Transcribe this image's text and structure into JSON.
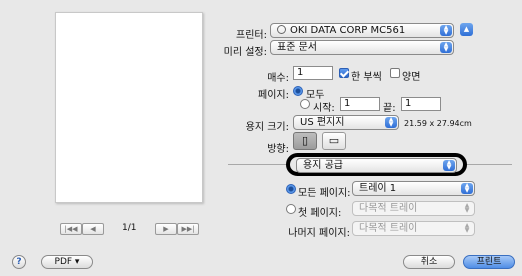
{
  "printer": {
    "label": "프린터:",
    "value": "OKI DATA CORP MC561"
  },
  "presets": {
    "label": "미리 설정:",
    "value": "표준 문서"
  },
  "copies": {
    "label": "매수:",
    "value": "1",
    "collated_label": "한 부씩",
    "two_sided_label": "양면"
  },
  "pages": {
    "label": "페이지:",
    "all_label": "모두",
    "from_label": "시작:",
    "from_value": "1",
    "to_label": "끝:",
    "to_value": "1"
  },
  "paper_size": {
    "label": "용지 크기:",
    "value": "US 편지지",
    "dims": "21.59 x 27.94cm"
  },
  "orientation": {
    "label": "방향:"
  },
  "section_popup": {
    "value": "용지 공급"
  },
  "paper_source": {
    "all_pages_label": "모든 페이지:",
    "all_pages_value": "트레이 1",
    "first_page_label": "첫 페이지:",
    "first_page_value": "다목적 트레이",
    "remaining_label": "나머지 페이지:",
    "remaining_value": "다목적 트레이"
  },
  "preview": {
    "page_indicator": "1/1"
  },
  "footer": {
    "help": "?",
    "pdf_label": "PDF ▾",
    "cancel_label": "취소",
    "print_label": "프린트"
  },
  "colors": {
    "accent": "#3a78dc",
    "highlight_outline": "#000000"
  }
}
